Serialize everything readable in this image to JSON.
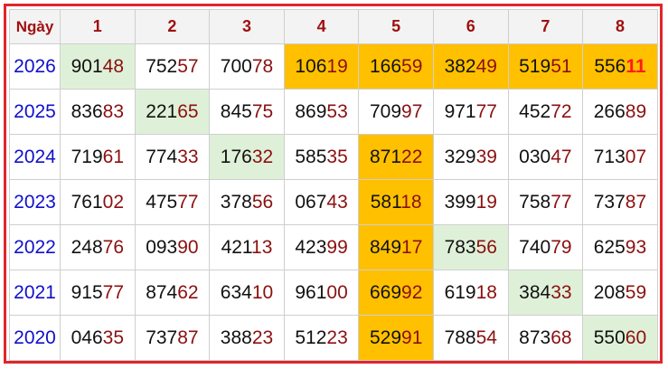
{
  "headers": [
    "Ngày",
    "1",
    "2",
    "3",
    "4",
    "5",
    "6",
    "7",
    "8"
  ],
  "colors": {
    "border": "#e0262b",
    "year_text": "#1010cc",
    "header_text": "#a01010",
    "tail_text": "#8b1010",
    "highlight_orange": "#ffc000",
    "highlight_green": "#dff0d8"
  },
  "rows": [
    {
      "year": "2026",
      "cells": [
        {
          "prefix": "901",
          "suffix": "48",
          "hl": "green"
        },
        {
          "prefix": "752",
          "suffix": "57",
          "hl": ""
        },
        {
          "prefix": "700",
          "suffix": "78",
          "hl": ""
        },
        {
          "prefix": "106",
          "suffix": "19",
          "hl": "orange"
        },
        {
          "prefix": "166",
          "suffix": "59",
          "hl": "orange"
        },
        {
          "prefix": "382",
          "suffix": "49",
          "hl": "orange"
        },
        {
          "prefix": "519",
          "suffix": "51",
          "hl": "orange"
        },
        {
          "prefix": "556",
          "suffix": "11",
          "hl": "orange",
          "red": true
        }
      ]
    },
    {
      "year": "2025",
      "cells": [
        {
          "prefix": "836",
          "suffix": "83",
          "hl": ""
        },
        {
          "prefix": "221",
          "suffix": "65",
          "hl": "green"
        },
        {
          "prefix": "845",
          "suffix": "75",
          "hl": ""
        },
        {
          "prefix": "869",
          "suffix": "53",
          "hl": ""
        },
        {
          "prefix": "709",
          "suffix": "97",
          "hl": ""
        },
        {
          "prefix": "971",
          "suffix": "77",
          "hl": ""
        },
        {
          "prefix": "452",
          "suffix": "72",
          "hl": ""
        },
        {
          "prefix": "266",
          "suffix": "89",
          "hl": ""
        }
      ]
    },
    {
      "year": "2024",
      "cells": [
        {
          "prefix": "719",
          "suffix": "61",
          "hl": ""
        },
        {
          "prefix": "774",
          "suffix": "33",
          "hl": ""
        },
        {
          "prefix": "176",
          "suffix": "32",
          "hl": "green"
        },
        {
          "prefix": "585",
          "suffix": "35",
          "hl": ""
        },
        {
          "prefix": "871",
          "suffix": "22",
          "hl": "orange"
        },
        {
          "prefix": "329",
          "suffix": "39",
          "hl": ""
        },
        {
          "prefix": "030",
          "suffix": "47",
          "hl": ""
        },
        {
          "prefix": "713",
          "suffix": "07",
          "hl": ""
        }
      ]
    },
    {
      "year": "2023",
      "cells": [
        {
          "prefix": "761",
          "suffix": "02",
          "hl": ""
        },
        {
          "prefix": "475",
          "suffix": "77",
          "hl": ""
        },
        {
          "prefix": "378",
          "suffix": "56",
          "hl": ""
        },
        {
          "prefix": "067",
          "suffix": "43",
          "hl": ""
        },
        {
          "prefix": "581",
          "suffix": "18",
          "hl": "orange"
        },
        {
          "prefix": "399",
          "suffix": "19",
          "hl": ""
        },
        {
          "prefix": "758",
          "suffix": "77",
          "hl": ""
        },
        {
          "prefix": "737",
          "suffix": "87",
          "hl": ""
        }
      ]
    },
    {
      "year": "2022",
      "cells": [
        {
          "prefix": "248",
          "suffix": "76",
          "hl": ""
        },
        {
          "prefix": "093",
          "suffix": "90",
          "hl": ""
        },
        {
          "prefix": "421",
          "suffix": "13",
          "hl": ""
        },
        {
          "prefix": "423",
          "suffix": "99",
          "hl": ""
        },
        {
          "prefix": "849",
          "suffix": "17",
          "hl": "orange"
        },
        {
          "prefix": "783",
          "suffix": "56",
          "hl": "green"
        },
        {
          "prefix": "740",
          "suffix": "79",
          "hl": ""
        },
        {
          "prefix": "625",
          "suffix": "93",
          "hl": ""
        }
      ]
    },
    {
      "year": "2021",
      "cells": [
        {
          "prefix": "915",
          "suffix": "77",
          "hl": ""
        },
        {
          "prefix": "874",
          "suffix": "62",
          "hl": ""
        },
        {
          "prefix": "634",
          "suffix": "10",
          "hl": ""
        },
        {
          "prefix": "961",
          "suffix": "00",
          "hl": ""
        },
        {
          "prefix": "669",
          "suffix": "92",
          "hl": "orange"
        },
        {
          "prefix": "619",
          "suffix": "18",
          "hl": ""
        },
        {
          "prefix": "384",
          "suffix": "33",
          "hl": "green"
        },
        {
          "prefix": "208",
          "suffix": "59",
          "hl": ""
        }
      ]
    },
    {
      "year": "2020",
      "cells": [
        {
          "prefix": "046",
          "suffix": "35",
          "hl": ""
        },
        {
          "prefix": "737",
          "suffix": "87",
          "hl": ""
        },
        {
          "prefix": "388",
          "suffix": "23",
          "hl": ""
        },
        {
          "prefix": "512",
          "suffix": "23",
          "hl": ""
        },
        {
          "prefix": "529",
          "suffix": "91",
          "hl": "orange"
        },
        {
          "prefix": "788",
          "suffix": "54",
          "hl": ""
        },
        {
          "prefix": "873",
          "suffix": "68",
          "hl": ""
        },
        {
          "prefix": "550",
          "suffix": "60",
          "hl": "green"
        }
      ]
    }
  ]
}
